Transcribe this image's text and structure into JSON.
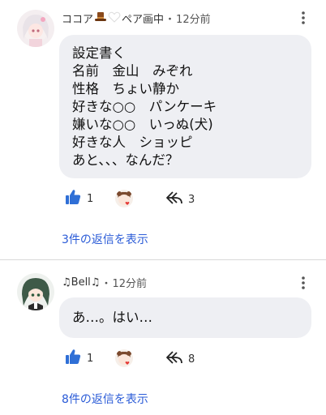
{
  "comments": [
    {
      "author": "ココア",
      "author_suffix": "ペア画中",
      "separator": "・",
      "time": "12分前",
      "lines": [
        "設定書く",
        "名前　金山　みぞれ",
        "性格　ちょい静か",
        "好きな○○　パンケーキ",
        "嫌いな○○　いっぬ(犬)",
        "好きな人　ショッピ",
        "あと、、、なんだ？"
      ],
      "likes": "1",
      "replies": "3",
      "view_replies": "3件の返信を表示"
    },
    {
      "author": "♫Bell♫",
      "author_suffix": "",
      "separator": "・",
      "time": "12分前",
      "lines": [
        "あ…。はい…"
      ],
      "likes": "1",
      "replies": "8",
      "view_replies": "8件の返信を表示"
    }
  ],
  "icons": {
    "menu": "more-vert-icon",
    "like": "thumb-up-icon",
    "reply": "reply-icon",
    "creator_heart": "creator-heart-avatar"
  },
  "colors": {
    "accent": "#2a5bd7",
    "like_blue": "#2f6fd6",
    "bubble": "#eeeff3"
  }
}
